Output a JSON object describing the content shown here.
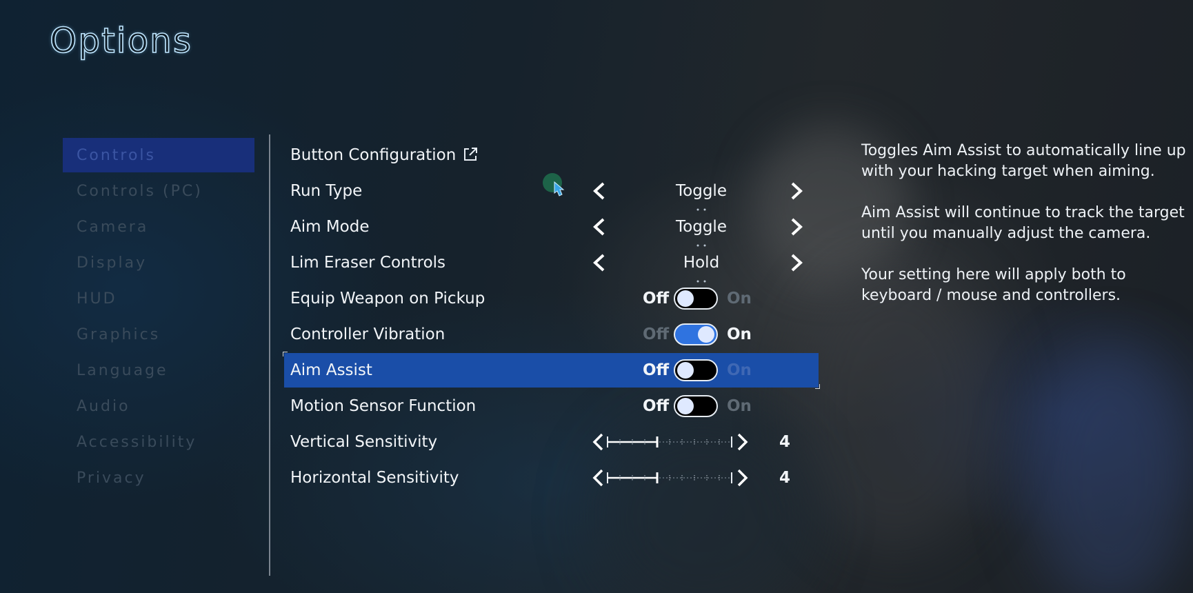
{
  "title": "Options",
  "sidebar": {
    "items": [
      {
        "label": "Controls",
        "active": true
      },
      {
        "label": "Controls (PC)",
        "active": false
      },
      {
        "label": "Camera",
        "active": false
      },
      {
        "label": "Display",
        "active": false
      },
      {
        "label": "HUD",
        "active": false
      },
      {
        "label": "Graphics",
        "active": false
      },
      {
        "label": "Language",
        "active": false
      },
      {
        "label": "Audio",
        "active": false
      },
      {
        "label": "Accessibility",
        "active": false
      },
      {
        "label": "Privacy",
        "active": false
      }
    ]
  },
  "options": {
    "button_config": {
      "label": "Button Configuration",
      "icon": "external-link-icon"
    },
    "run_type": {
      "label": "Run Type",
      "value": "Toggle"
    },
    "aim_mode": {
      "label": "Aim Mode",
      "value": "Toggle"
    },
    "lim_eraser": {
      "label": "Lim Eraser Controls",
      "value": "Hold"
    },
    "equip_weapon": {
      "label": "Equip Weapon on Pickup",
      "off_label": "Off",
      "on_label": "On",
      "state": false
    },
    "controller_vibration": {
      "label": "Controller Vibration",
      "off_label": "Off",
      "on_label": "On",
      "state": true
    },
    "aim_assist": {
      "label": "Aim Assist",
      "off_label": "Off",
      "on_label": "On",
      "state": false,
      "selected": true
    },
    "motion_sensor": {
      "label": "Motion Sensor Function",
      "off_label": "Off",
      "on_label": "On",
      "state": false
    },
    "vertical_sensitivity": {
      "label": "Vertical Sensitivity",
      "value": "4",
      "level": 4,
      "max": 10
    },
    "horizontal_sensitivity": {
      "label": "Horizontal Sensitivity",
      "value": "4",
      "level": 4,
      "max": 10
    }
  },
  "help": {
    "p1_line1": "Toggles Aim Assist to automatically line up",
    "p1_line2": "with your hacking target when aiming.",
    "p2_line1": "Aim Assist will continue to track the target",
    "p2_line2": "until you manually adjust the camera.",
    "p3_line1": "Your setting here will apply both to",
    "p3_line2": "keyboard / mouse and controllers."
  },
  "colors": {
    "accent_blue": "#1a4ea8",
    "toggle_on": "#2f73e0",
    "sidebar_active": "#182f7a"
  }
}
